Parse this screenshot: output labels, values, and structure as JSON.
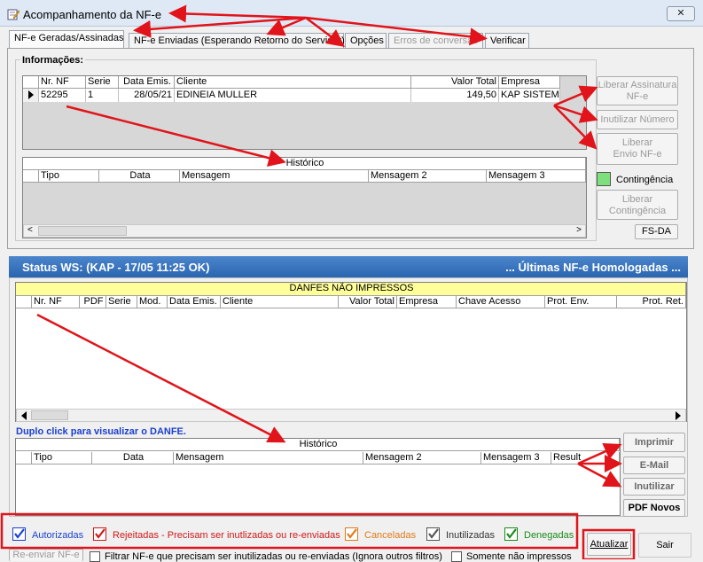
{
  "window": {
    "title": "Acompanhamento da NF-e",
    "close": "✕"
  },
  "tabs": [
    {
      "label": "NF-e Geradas/Assinadas"
    },
    {
      "label": "NF-e Enviadas (Esperando Retorno do Servidor)"
    },
    {
      "label": "Opções"
    },
    {
      "label": "Erros de conversão"
    },
    {
      "label": "Verificar"
    }
  ],
  "info": {
    "label": "Informações:",
    "columns": [
      "Nr. NF",
      "Serie",
      "Data Emis.",
      "Cliente",
      "Valor Total",
      "Empresa"
    ],
    "rows": [
      {
        "nr": "52295",
        "serie": "1",
        "data": "28/05/21",
        "cliente": "EDINEIA MULLER",
        "valor": "149,50",
        "empresa": "KAP SISTEMA"
      }
    ],
    "historico": {
      "title": "Histórico",
      "columns": [
        "Tipo",
        "Data",
        "Mensagem",
        "Mensagem 2",
        "Mensagem 3"
      ]
    }
  },
  "side_buttons": {
    "liberar_assinatura": "Liberar Assinatura NF-e",
    "inutilizar_numero": "Inutilizar Número",
    "liberar_envio": "Liberar Envio NF-e",
    "contingencia_label": "Contingência",
    "liberar_contingencia": "Liberar Contingência",
    "fsda": "FS-DA"
  },
  "status": {
    "left": "Status WS: (KAP - 17/05 11:25 OK)",
    "right": "... Últimas NF-e Homologadas ..."
  },
  "danfe": {
    "title": "DANFES NÃO IMPRESSOS",
    "columns": [
      "Nr. NF",
      "PDF",
      "Serie",
      "Mod.",
      "Data Emis.",
      "Cliente",
      "Valor Total",
      "Empresa",
      "Chave Acesso",
      "Prot. Env.",
      "Prot. Ret."
    ],
    "hint": "Duplo click para visualizar o DANFE.",
    "historico": {
      "title": "Histórico",
      "columns": [
        "Tipo",
        "Data",
        "Mensagem",
        "Mensagem 2",
        "Mensagem 3",
        "Result"
      ]
    }
  },
  "right_buttons": {
    "imprimir": "Imprimir",
    "email": "E-Mail",
    "inutilizar": "Inutilizar",
    "pdf_novos": "PDF Novos"
  },
  "legend": {
    "autorizadas": "Autorizadas",
    "rejeitadas": "Rejeitadas - Precisam ser inutlizadas ou re-enviadas",
    "canceladas": "Canceladas",
    "inutilizadas": "Inutilizadas",
    "denegadas": "Denegadas"
  },
  "colors": {
    "autorizadas": "#1a3fd0",
    "rejeitadas": "#d01818",
    "canceladas": "#e07a18",
    "inutilizadas": "#555555",
    "denegadas": "#1a8a1a",
    "annotation": "#e0141a"
  },
  "footer": {
    "reenviar": "Re-enviar NF-e",
    "filtrar": "Filtrar NF-e que precisam ser inutilizadas ou re-enviadas (Ignora outros filtros)",
    "somente": "Somente não impressos",
    "atualizar": "Atualizar",
    "sair": "Sair"
  }
}
